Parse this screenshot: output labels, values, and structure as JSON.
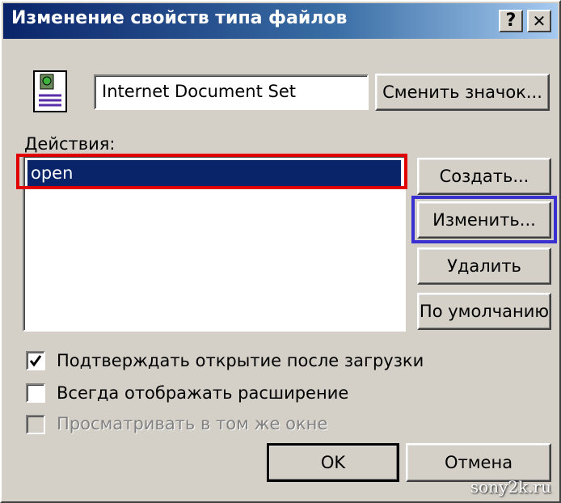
{
  "window": {
    "title": "Изменение свойств типа файлов",
    "help_label": "?",
    "close_label": "✕"
  },
  "file_type": {
    "name_value": "Internet Document Set",
    "change_icon_label": "Сменить значок..."
  },
  "actions": {
    "label": "Действия:",
    "items": [
      "open"
    ],
    "selected": "open"
  },
  "buttons": {
    "create": "Создать...",
    "edit": "Изменить...",
    "delete": "Удалить",
    "default": "По умолчанию",
    "ok": "OK",
    "cancel": "Отмена"
  },
  "options": {
    "confirm_open": {
      "label": "Подтверждать открытие после загрузки",
      "checked": true
    },
    "always_show_ext": {
      "label": "Всегда отображать расширение",
      "checked": false
    },
    "browse_same_window": {
      "label": "Просматривать в том же окне",
      "checked": false,
      "disabled": true
    }
  },
  "highlights": {
    "red": "#e00000",
    "blue": "#3a2fd0"
  },
  "watermark": "sony2k.ru"
}
